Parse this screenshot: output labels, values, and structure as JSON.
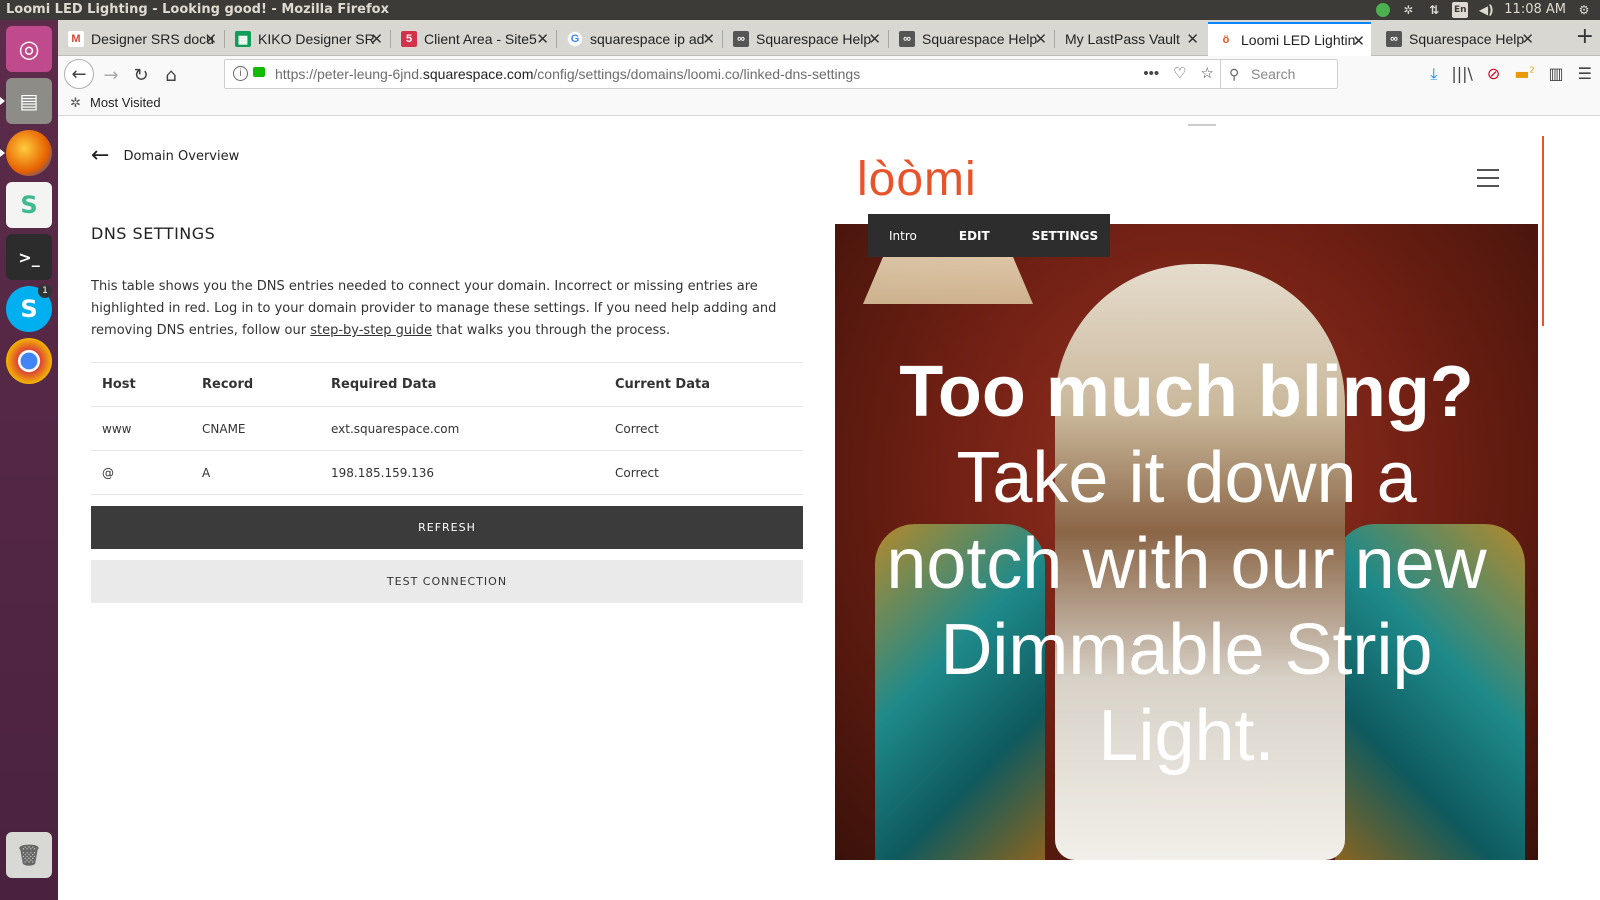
{
  "window": {
    "title": "Loomi LED Lighting - Looking good! - Mozilla Firefox",
    "clock": "11:08 AM",
    "keyboard_layout": "En"
  },
  "tabs": [
    {
      "label": "Designer SRS docu",
      "icon": "gmail-icon",
      "color": "#d44638"
    },
    {
      "label": "KIKO Designer SR",
      "icon": "sheets-icon",
      "color": "#0f9d58"
    },
    {
      "label": "Client Area - Site5",
      "icon": "site5-icon",
      "color": "#d2334a"
    },
    {
      "label": "squarespace ip ad",
      "icon": "google-icon",
      "color": "#4285f4"
    },
    {
      "label": "Squarespace Help",
      "icon": "squarespace-icon",
      "color": "#222222"
    },
    {
      "label": "Squarespace Help",
      "icon": "squarespace-icon",
      "color": "#222222"
    },
    {
      "label": "My LastPass Vault",
      "icon": "lastpass-icon",
      "color": "#cccccc"
    },
    {
      "label": "Loomi LED Lightin",
      "icon": "loomi-icon",
      "color": "#e8542a",
      "active": true
    },
    {
      "label": "Squarespace Help",
      "icon": "squarespace-icon",
      "color": "#222222"
    }
  ],
  "navbar": {
    "url_prefix": "https://peter-leung-6jnd.",
    "url_domain": "squarespace.com",
    "url_path": "/config/settings/domains/loomi.co/linked-dns-settings",
    "search_placeholder": "Search",
    "pocket_badge": "2"
  },
  "bookmarks": {
    "most_visited": "Most Visited"
  },
  "panel": {
    "back_label": "Domain Overview",
    "title": "DNS SETTINGS",
    "desc_before": "This table shows you the DNS entries needed to connect your domain. Incorrect or missing entries are highlighted in red. Log in to your domain provider to manage these settings. If you need help adding and removing DNS entries, follow our ",
    "desc_link": "step-by-step guide",
    "desc_after": " that walks you through the process.",
    "columns": [
      "Host",
      "Record",
      "Required Data",
      "Current Data"
    ],
    "rows": [
      {
        "host": "www",
        "record": "CNAME",
        "required": "ext.squarespace.com",
        "current": "Correct"
      },
      {
        "host": "@",
        "record": "A",
        "required": "198.185.159.136",
        "current": "Correct"
      }
    ],
    "refresh_label": "REFRESH",
    "test_label": "TEST CONNECTION",
    "status_color": "#5fb130"
  },
  "preview": {
    "logo": "lòòmi",
    "brand_color": "#e8542a",
    "edit_tabs": [
      "Intro",
      "EDIT",
      "SETTINGS"
    ],
    "hero_lines": [
      "Too much bling?",
      "Take it down a",
      "notch with our new",
      "Dimmable Strip",
      "Light."
    ]
  },
  "launcher": {
    "items": [
      "ubuntu-dash-icon",
      "files-icon",
      "firefox-icon",
      "slack-icon",
      "terminal-icon",
      "skype-icon",
      "chrome-icon",
      "trash-icon"
    ],
    "skype_badge": "1"
  }
}
